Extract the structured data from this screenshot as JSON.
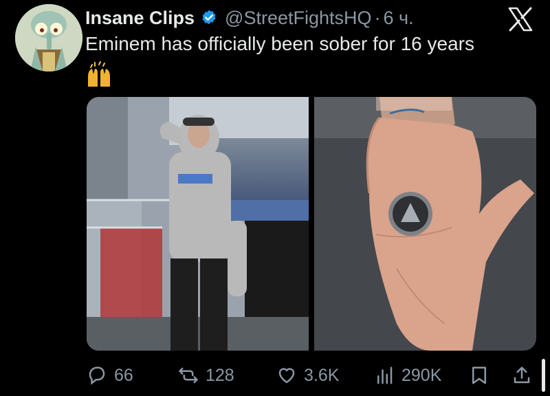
{
  "author": {
    "name": "Insane Clips",
    "handle": "@StreetFightsHQ",
    "separator": "·",
    "time": "6 ч."
  },
  "tweet": {
    "text": "Eminem has officially been sober for 16 years"
  },
  "stats": {
    "replies": "66",
    "reposts": "128",
    "likes": "3.6K",
    "views": "290K"
  },
  "colors": {
    "background": "#000000",
    "verified": "#1d9bf0",
    "muted": "#8b98a5",
    "text": "#e7e9ea"
  },
  "icons": [
    "verified-badge-icon",
    "x-logo-icon",
    "raising-hands-emoji",
    "reply-icon",
    "repost-icon",
    "like-icon",
    "views-icon",
    "bookmark-icon",
    "share-icon"
  ]
}
